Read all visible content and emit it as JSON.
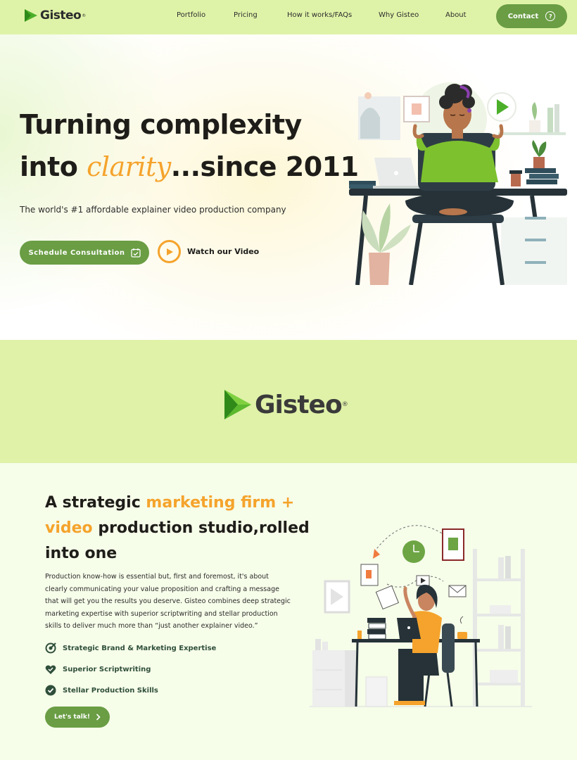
{
  "brand": {
    "name": "Gisteo",
    "reg": "®"
  },
  "nav": {
    "links": [
      "Portfolio",
      "Pricing",
      "How it works/FAQs",
      "Why Gisteo",
      "About"
    ],
    "contact_label": "Contact"
  },
  "hero": {
    "title_line1": "Turning complexity",
    "title_line2_pre": "into ",
    "title_line2_accent": "clarity",
    "title_line2_post": "...since 2011",
    "subtitle": "The world's #1 affordable explainer video production company",
    "schedule_label": "Schedule Consultation",
    "watch_label": "Watch our Video"
  },
  "section": {
    "heading_l1_pre": "A strategic ",
    "heading_l1_accent": "marketing firm +",
    "heading_l2_accent": "video",
    "heading_l2_post": " production studio,rolled",
    "heading_l3": "into one",
    "paragraph": "Production know-how is essential but, first and foremost, it's about clearly communicating your value proposition and crafting a message that will get you the results you deserve. Gisteo combines deep strategic marketing expertise with superior scriptwriting and stellar production skills to deliver much more than “just another explainer video.”",
    "features": [
      "Strategic Brand & Marketing Expertise",
      "Superior Scriptwriting",
      "Stellar Production Skills"
    ],
    "cta_label": "Let's talk!"
  },
  "colors": {
    "accent_green": "#6a9d44",
    "accent_orange": "#f5a32c",
    "band_bg": "#dff2a8"
  },
  "icons": [
    "play-logo-icon",
    "help-circle-icon",
    "calendar-check-icon",
    "play-circle-icon",
    "target-check-icon",
    "heart-check-icon",
    "check-circle-icon",
    "chevron-right-icon"
  ]
}
